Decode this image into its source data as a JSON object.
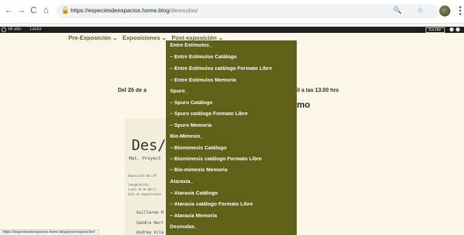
{
  "browser": {
    "url_domain": "https://especiesdeespacios.home.blog",
    "url_path": "/desnudas/",
    "back_glyph": "←",
    "forward_glyph": "→",
    "reload_glyph": "C",
    "home_glyph": "⌂",
    "url_icon_glyphs": "🔍 ☆"
  },
  "adminbar": {
    "my_site": "Mi sitio",
    "reader": "Lector",
    "write": "Escribir"
  },
  "nav": {
    "items": [
      "Pre-Exposición ⌄",
      "Exposiciones ⌄",
      "Post-exposición ⌄"
    ]
  },
  "content": {
    "date_left": "Del 26 de a",
    "date_right": "il a las 13.00 hrs",
    "mo": "mo"
  },
  "poster": {
    "title": "Des/",
    "subtitle": "Mat. Proyect",
    "expo": "Exposición del 29",
    "inaug_label": "Inauguración:",
    "inaug_date": "Lunes 29 de Abril",
    "sala": "Sala de exposiciones",
    "names": [
      "Guillermo M",
      "Sandra Herr",
      "Andrea Vila"
    ]
  },
  "dropdown": {
    "items": [
      "Entre Estímulos_",
      "– Entre Estímulos Catálogo",
      "– Entre Estímulos catálogo Formato Libre",
      "– Entre Estímulos Memoria",
      "Spuro_",
      "– Spuro Catálogo",
      "– Spuro catálogo Formato Libre",
      "– Spuro Memoria",
      "Bio-Mimesis_",
      "– Biomimesis Catálogo",
      "– Biomimesis catálogo Formato Libre",
      "– Bio-mimesis Memoria",
      "Ataraxia_",
      "– Ataraxia Catálogo",
      "– Ataraxia catálogo Formato Libre",
      "– Ataraxia Memoria",
      "Desnudas_"
    ]
  },
  "status": {
    "link": "https://especiesdeespacios.home.blog/post-exposicion/"
  },
  "colors": {
    "dropdown_bg": "#606118",
    "nav_text": "#5e5e28",
    "page_bg": "#fbf8ea"
  }
}
